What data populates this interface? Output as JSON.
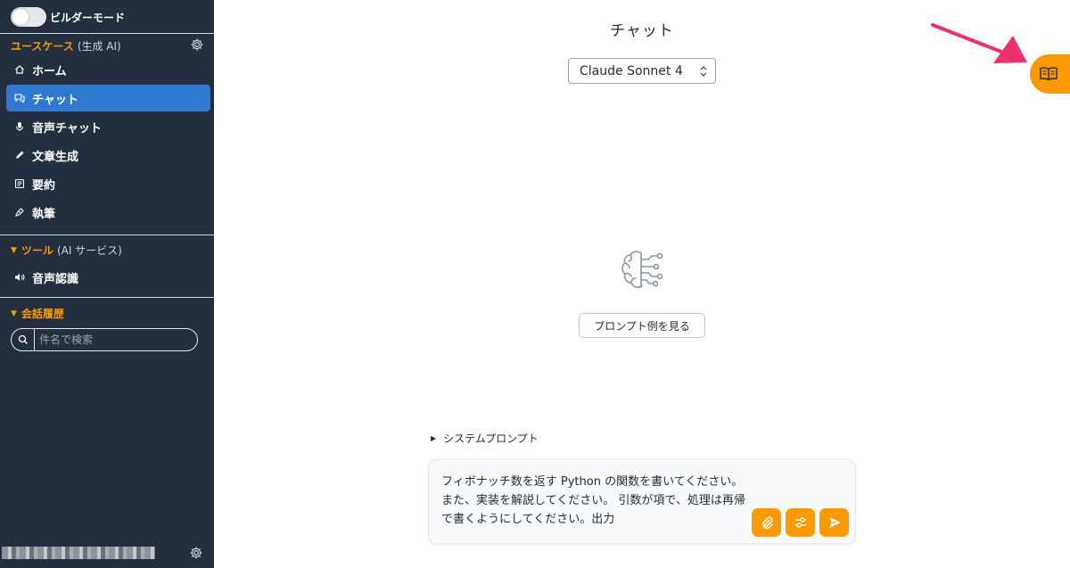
{
  "sidebar": {
    "builder_mode_label": "ビルダーモード",
    "usecase_section": {
      "title": "ユースケース",
      "subtitle": "(生成 AI)"
    },
    "usecase_items": [
      {
        "label": "ホーム",
        "icon": "home-icon"
      },
      {
        "label": "チャット",
        "icon": "chat-icon",
        "active": true
      },
      {
        "label": "音声チャット",
        "icon": "mic-icon"
      },
      {
        "label": "文章生成",
        "icon": "pencil-icon"
      },
      {
        "label": "要約",
        "icon": "summary-icon"
      },
      {
        "label": "執筆",
        "icon": "pen-icon"
      }
    ],
    "tools_section": {
      "title": "ツール",
      "subtitle": "(AI サービス)"
    },
    "tool_items": [
      {
        "label": "音声認識",
        "icon": "speaker-icon"
      }
    ],
    "history_section": {
      "title": "会話履歴"
    },
    "search": {
      "placeholder": "件名で検索"
    }
  },
  "main": {
    "title": "チャット",
    "model_select": {
      "value": "Claude Sonnet 4"
    },
    "prompt_examples_button": "プロンプト例を見る",
    "system_prompt_label": "システムプロンプト",
    "chat_input": {
      "value": "フィボナッチ数を返す Python の関数を書いてください。また、実装を解説してください。 引数が項で、処理は再帰で書くようにしてください。出力"
    }
  },
  "colors": {
    "sidebar_bg": "#232f3e",
    "accent": "#ff9900",
    "active_nav": "#2f78cf",
    "annotation_arrow": "#f0306a"
  }
}
